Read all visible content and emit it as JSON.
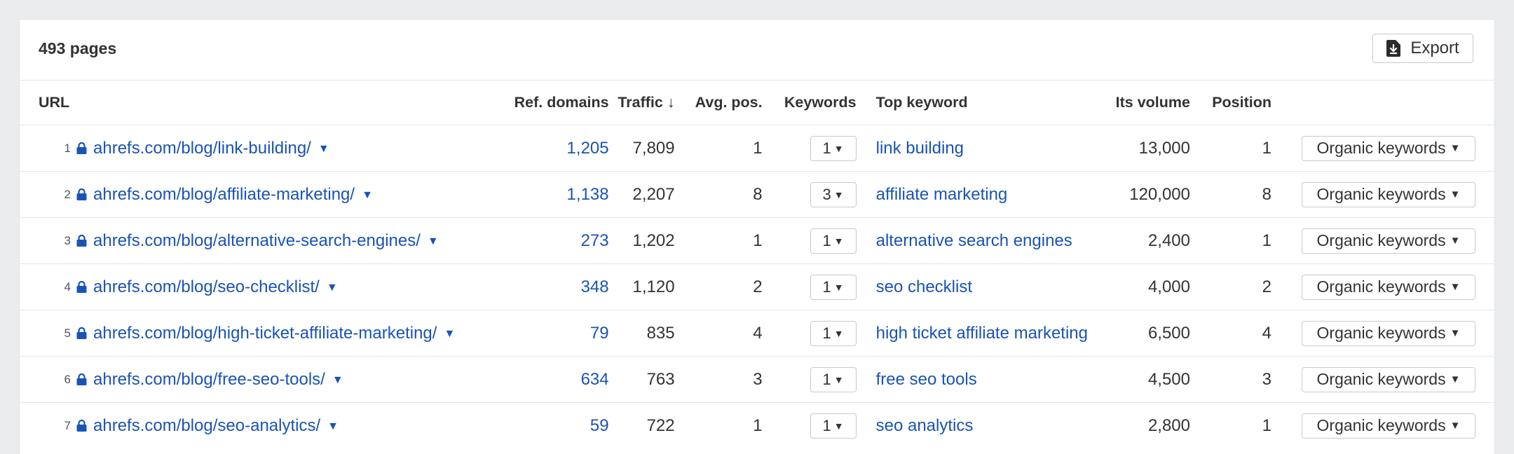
{
  "header": {
    "page_count": "493 pages",
    "export_label": "Export"
  },
  "columns": {
    "url": "URL",
    "ref_domains": "Ref. domains",
    "traffic": "Traffic",
    "traffic_sort": "↓",
    "avg_pos": "Avg. pos.",
    "keywords": "Keywords",
    "top_keyword": "Top keyword",
    "its_volume": "Its volume",
    "position": "Position"
  },
  "rows": [
    {
      "num": "1",
      "url": "ahrefs.com/blog/link-building/",
      "ref_domains": "1,205",
      "traffic": "7,809",
      "avg_pos": "1",
      "keywords": "1",
      "top_keyword": "link building",
      "volume": "13,000",
      "position": "1",
      "action": "Organic keywords"
    },
    {
      "num": "2",
      "url": "ahrefs.com/blog/affiliate-marketing/",
      "ref_domains": "1,138",
      "traffic": "2,207",
      "avg_pos": "8",
      "keywords": "3",
      "top_keyword": "affiliate marketing",
      "volume": "120,000",
      "position": "8",
      "action": "Organic keywords"
    },
    {
      "num": "3",
      "url": "ahrefs.com/blog/alternative-search-engines/",
      "ref_domains": "273",
      "traffic": "1,202",
      "avg_pos": "1",
      "keywords": "1",
      "top_keyword": "alternative search engines",
      "volume": "2,400",
      "position": "1",
      "action": "Organic keywords"
    },
    {
      "num": "4",
      "url": "ahrefs.com/blog/seo-checklist/",
      "ref_domains": "348",
      "traffic": "1,120",
      "avg_pos": "2",
      "keywords": "1",
      "top_keyword": "seo checklist",
      "volume": "4,000",
      "position": "2",
      "action": "Organic keywords"
    },
    {
      "num": "5",
      "url": "ahrefs.com/blog/high-ticket-affiliate-marketing/",
      "ref_domains": "79",
      "traffic": "835",
      "avg_pos": "4",
      "keywords": "1",
      "top_keyword": "high ticket affiliate marketing",
      "volume": "6,500",
      "position": "4",
      "action": "Organic keywords"
    },
    {
      "num": "6",
      "url": "ahrefs.com/blog/free-seo-tools/",
      "ref_domains": "634",
      "traffic": "763",
      "avg_pos": "3",
      "keywords": "1",
      "top_keyword": "free seo tools",
      "volume": "4,500",
      "position": "3",
      "action": "Organic keywords"
    },
    {
      "num": "7",
      "url": "ahrefs.com/blog/seo-analytics/",
      "ref_domains": "59",
      "traffic": "722",
      "avg_pos": "1",
      "keywords": "1",
      "top_keyword": "seo analytics",
      "volume": "2,800",
      "position": "1",
      "action": "Organic keywords"
    }
  ],
  "icons": {
    "lock": "lock-icon",
    "caret": "caret-down-icon",
    "export": "download-icon"
  },
  "colors": {
    "link": "#1a53b4",
    "border": "#c8cacd",
    "background": "#ebecee"
  }
}
